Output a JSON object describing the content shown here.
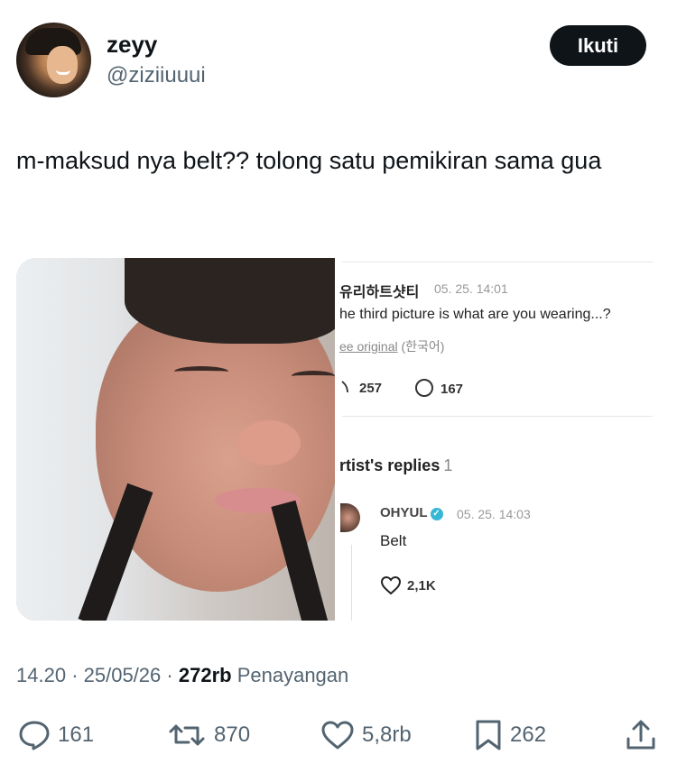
{
  "user": {
    "display_name": "zeyy",
    "handle": "@ziziiuuui",
    "follow_label": "Ikuti"
  },
  "tweet": {
    "text": "m-maksud nya belt?? tolong satu pemikiran sama gua"
  },
  "embedded_screenshot": {
    "comment": {
      "username": "유리하트샷티",
      "time": "05. 25. 14:01",
      "text": "he third picture is what are you wearing...?",
      "see_original": "ee original",
      "language": "(한국어)",
      "likes": "257",
      "comments": "167"
    },
    "replies": {
      "title": "rtist's replies",
      "count": "1"
    },
    "reply": {
      "name": "OHYUL",
      "time": "05. 25. 14:03",
      "text": "Belt",
      "likes": "2,1K"
    }
  },
  "meta": {
    "time": "14.20",
    "separator": "·",
    "date": "25/05/26",
    "views_count": "272rb",
    "views_label": "Penayangan"
  },
  "actions": {
    "reply_count": "161",
    "repost_count": "870",
    "like_count": "5,8rb",
    "bookmark_count": "262"
  },
  "icons": [
    "reply-icon",
    "repost-icon",
    "like-icon",
    "bookmark-icon",
    "share-icon",
    "heart-icon",
    "comment-bubble-icon",
    "verified-icon"
  ],
  "colors": {
    "primary_text": "#0f1419",
    "secondary_text": "#536471",
    "button_bg": "#0f1419",
    "verified": "#37b6d6"
  }
}
